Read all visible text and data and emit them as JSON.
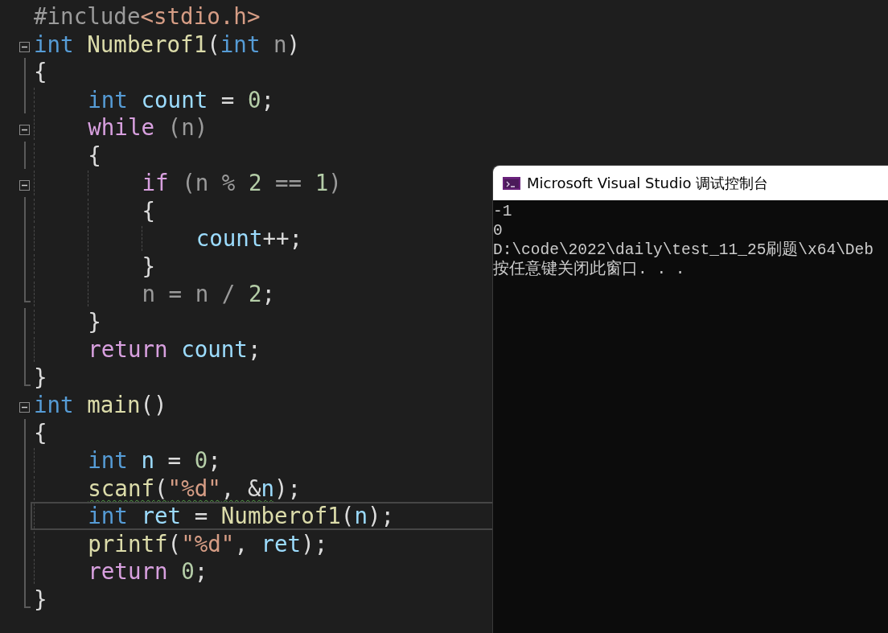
{
  "editor": {
    "lines": [
      {
        "kind": "plain",
        "current": false,
        "tokens": [
          {
            "kind": "preproc",
            "text": "#include"
          },
          {
            "kind": "string",
            "text": "<stdio.h>"
          }
        ]
      },
      {
        "kind": "fold",
        "current": false,
        "tokens": [
          {
            "kind": "keyword",
            "text": "int"
          },
          {
            "kind": "function",
            "text": " Numberof1"
          },
          {
            "kind": "plain",
            "text": "("
          },
          {
            "kind": "keyword",
            "text": "int"
          },
          {
            "kind": "param",
            "text": " n"
          },
          {
            "kind": "plain",
            "text": ")"
          }
        ]
      },
      {
        "kind": "inside",
        "current": false,
        "tokens": [
          {
            "kind": "plain",
            "text": "{"
          }
        ]
      },
      {
        "kind": "inside",
        "current": false,
        "tokens": [
          {
            "kind": "keyword",
            "text": "    int"
          },
          {
            "kind": "variable",
            "text": " count"
          },
          {
            "kind": "plain",
            "text": " = "
          },
          {
            "kind": "number",
            "text": "0"
          },
          {
            "kind": "plain",
            "text": ";"
          }
        ]
      },
      {
        "kind": "fold",
        "current": false,
        "tokens": [
          {
            "kind": "control",
            "text": "    while"
          },
          {
            "kind": "param",
            "text": " (n)"
          }
        ]
      },
      {
        "kind": "inside",
        "current": false,
        "tokens": [
          {
            "kind": "plain",
            "text": "    {"
          }
        ]
      },
      {
        "kind": "fold",
        "current": false,
        "tokens": [
          {
            "kind": "control",
            "text": "        if"
          },
          {
            "kind": "param",
            "text": " (n % "
          },
          {
            "kind": "number",
            "text": "2"
          },
          {
            "kind": "param",
            "text": " == "
          },
          {
            "kind": "number",
            "text": "1"
          },
          {
            "kind": "param",
            "text": ")"
          }
        ]
      },
      {
        "kind": "inside",
        "current": false,
        "tokens": [
          {
            "kind": "plain",
            "text": "        {"
          }
        ]
      },
      {
        "kind": "inside",
        "current": false,
        "tokens": [
          {
            "kind": "variable",
            "text": "            count"
          },
          {
            "kind": "plain",
            "text": "++;"
          }
        ]
      },
      {
        "kind": "inside",
        "current": false,
        "tokens": [
          {
            "kind": "plain",
            "text": "        }"
          }
        ]
      },
      {
        "kind": "end",
        "current": false,
        "tokens": [
          {
            "kind": "param",
            "text": "        n = n / "
          },
          {
            "kind": "number",
            "text": "2"
          },
          {
            "kind": "plain",
            "text": ";"
          }
        ]
      },
      {
        "kind": "inside",
        "current": false,
        "tokens": [
          {
            "kind": "plain",
            "text": "    }"
          }
        ]
      },
      {
        "kind": "inside",
        "current": false,
        "tokens": [
          {
            "kind": "control",
            "text": "    return"
          },
          {
            "kind": "variable",
            "text": " count"
          },
          {
            "kind": "plain",
            "text": ";"
          }
        ]
      },
      {
        "kind": "end",
        "current": false,
        "tokens": [
          {
            "kind": "plain",
            "text": "}"
          }
        ]
      },
      {
        "kind": "fold",
        "current": false,
        "tokens": [
          {
            "kind": "keyword",
            "text": "int"
          },
          {
            "kind": "function",
            "text": " main"
          },
          {
            "kind": "plain",
            "text": "()"
          }
        ]
      },
      {
        "kind": "inside",
        "current": false,
        "tokens": [
          {
            "kind": "plain",
            "text": "{"
          }
        ]
      },
      {
        "kind": "inside",
        "current": false,
        "tokens": [
          {
            "kind": "keyword",
            "text": "    int"
          },
          {
            "kind": "variable",
            "text": " n"
          },
          {
            "kind": "plain",
            "text": " = "
          },
          {
            "kind": "number",
            "text": "0"
          },
          {
            "kind": "plain",
            "text": ";"
          }
        ]
      },
      {
        "kind": "inside",
        "current": false,
        "tokens": [
          {
            "kind": "function",
            "text": "    scanf",
            "warning": true
          },
          {
            "kind": "plain",
            "text": "(",
            "warning": true
          },
          {
            "kind": "string",
            "text": "\"%d\"",
            "warning": true
          },
          {
            "kind": "plain",
            "text": ", &",
            "warning": true
          },
          {
            "kind": "variable",
            "text": "n",
            "warning": true
          },
          {
            "kind": "plain",
            "text": ");",
            "warning": false
          }
        ]
      },
      {
        "kind": "inside",
        "current": true,
        "tokens": [
          {
            "kind": "keyword",
            "text": "    int"
          },
          {
            "kind": "variable",
            "text": " ret"
          },
          {
            "kind": "plain",
            "text": " = "
          },
          {
            "kind": "function",
            "text": "Numberof1"
          },
          {
            "kind": "plain",
            "text": "("
          },
          {
            "kind": "variable",
            "text": "n"
          },
          {
            "kind": "plain",
            "text": ");"
          }
        ]
      },
      {
        "kind": "inside",
        "current": false,
        "tokens": [
          {
            "kind": "function",
            "text": "    printf"
          },
          {
            "kind": "plain",
            "text": "("
          },
          {
            "kind": "string",
            "text": "\"%d\""
          },
          {
            "kind": "plain",
            "text": ", "
          },
          {
            "kind": "variable",
            "text": "ret"
          },
          {
            "kind": "plain",
            "text": ");"
          }
        ]
      },
      {
        "kind": "inside",
        "current": false,
        "tokens": [
          {
            "kind": "control",
            "text": "    return"
          },
          {
            "kind": "number",
            "text": " 0"
          },
          {
            "kind": "plain",
            "text": ";"
          }
        ]
      },
      {
        "kind": "end",
        "current": false,
        "tokens": [
          {
            "kind": "plain",
            "text": "}"
          }
        ]
      }
    ]
  },
  "console": {
    "title": "Microsoft Visual Studio 调试控制台",
    "lines": [
      "-1",
      "0",
      "D:\\code\\2022\\daily\\test_11_25刷题\\x64\\Deb",
      "按任意键关闭此窗口. . ."
    ]
  }
}
